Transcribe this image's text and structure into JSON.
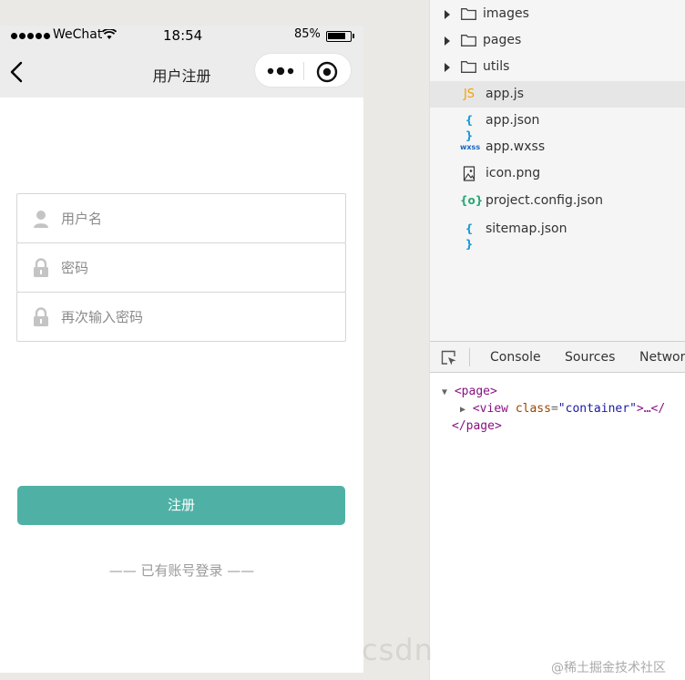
{
  "status_bar": {
    "carrier": "WeChat",
    "time": "18:54",
    "battery": "85%",
    "battery_level": 0.85
  },
  "nav": {
    "title": "用户注册"
  },
  "form": {
    "username_placeholder": "用户名",
    "password_placeholder": "密码",
    "confirm_placeholder": "再次输入密码",
    "register_label": "注册",
    "login_link": "—— 已有账号登录 ——"
  },
  "file_tree": {
    "items": [
      {
        "name": "images",
        "type": "folder"
      },
      {
        "name": "pages",
        "type": "folder"
      },
      {
        "name": "utils",
        "type": "folder"
      },
      {
        "name": "app.js",
        "type": "js",
        "icon": "JS"
      },
      {
        "name": "app.json",
        "type": "json",
        "icon": "{ }"
      },
      {
        "name": "app.wxss",
        "type": "wxss",
        "icon": "wxss"
      },
      {
        "name": "icon.png",
        "type": "image"
      },
      {
        "name": "project.config.json",
        "type": "config",
        "icon": "{o}"
      },
      {
        "name": "sitemap.json",
        "type": "json",
        "icon": "{ }"
      }
    ]
  },
  "devtools": {
    "tabs": [
      "Console",
      "Sources",
      "Network"
    ],
    "dom": {
      "page_open": "<page>",
      "view_tag": "<view",
      "attr_name": "class",
      "attr_value": "\"container\"",
      "view_rest": ">…</",
      "page_close": "</page>"
    }
  },
  "watermark": "csdn",
  "credit": "@稀土掘金技术社区",
  "colors": {
    "accent": "#4fb1a5",
    "selected_row": "#e6e6e6",
    "js": "#f0a30a",
    "json": "#1e9bd7",
    "wxss": "#1565c0",
    "config": "#2aa876"
  }
}
